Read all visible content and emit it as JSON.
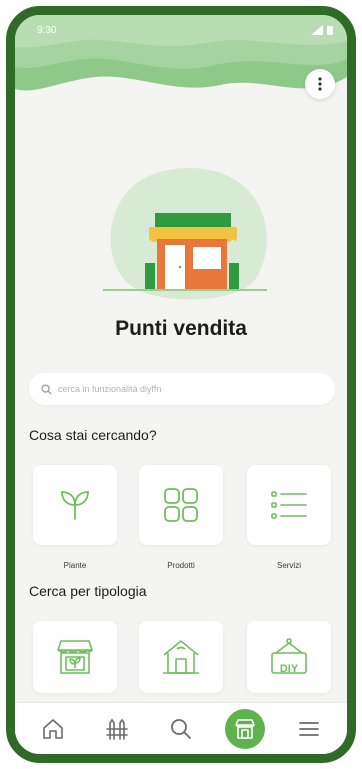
{
  "status_bar": {
    "time": "9:30"
  },
  "header": {
    "title": "Punti vendita"
  },
  "search": {
    "placeholder": "cerca in funzionalità diyffn"
  },
  "section_what": {
    "title": "Cosa stai cercando?",
    "items": [
      {
        "label": "Piante",
        "icon": "sprout-icon"
      },
      {
        "label": "Prodotti",
        "icon": "grid-icon"
      },
      {
        "label": "Servizi",
        "icon": "list-icon"
      }
    ]
  },
  "section_type": {
    "title": "Cerca per tipologia",
    "items": [
      {
        "icon": "plant-shop-icon"
      },
      {
        "icon": "store-house-icon"
      },
      {
        "label": "DIY",
        "icon": "diy-sign-icon"
      }
    ]
  },
  "bottom_nav": {
    "items": [
      "home-icon",
      "garden-icon",
      "search-icon",
      "store-icon",
      "menu-icon"
    ],
    "active": "store-icon"
  },
  "colors": {
    "frame": "#2f6a27",
    "accent": "#5fb34f",
    "icon_green": "#6fbf5e",
    "header_green": "#8fc98a"
  }
}
